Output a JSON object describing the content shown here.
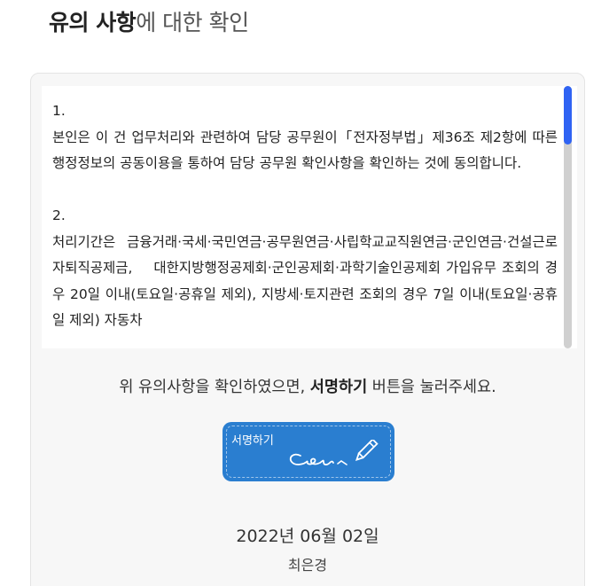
{
  "header": {
    "title_bold": "유의 사항",
    "title_rest": "에 대한 확인"
  },
  "terms": {
    "items": [
      {
        "number": "1.",
        "text": "본인은 이 건 업무처리와 관련하여 담당 공무원이「전자정부법」제36조 제2항에 따른 행정정보의 공동이용을 통하여 담당 공무원 확인사항을 확인하는 것에 동의합니다."
      },
      {
        "number": "2.",
        "text": "처리기간은  금융거래·국세·국민연금·공무원연금·사립학교교직원연금·군인연금·건설근로자퇴직공제금,    대한지방행정공제회·군인공제회·과학기술인공제회 가입유무 조회의 경우 20일 이내(토요일·공휴일 제외), 지방세·토지관련 조회의 경우 7일 이내(토요일·공휴일 제외) 자동차"
      }
    ]
  },
  "instruction": {
    "before": "위 유의사항을 확인하였으면, ",
    "bold": "서명하기",
    "after": " 버튼을 눌러주세요."
  },
  "sign_button": {
    "label": "서명하기",
    "icon": "signature-pen-icon"
  },
  "signature": {
    "date": "2022년 06월 02일",
    "name": "최은경"
  },
  "colors": {
    "accent": "#2a7ed0",
    "scroll_thumb": "#2f63f3"
  }
}
